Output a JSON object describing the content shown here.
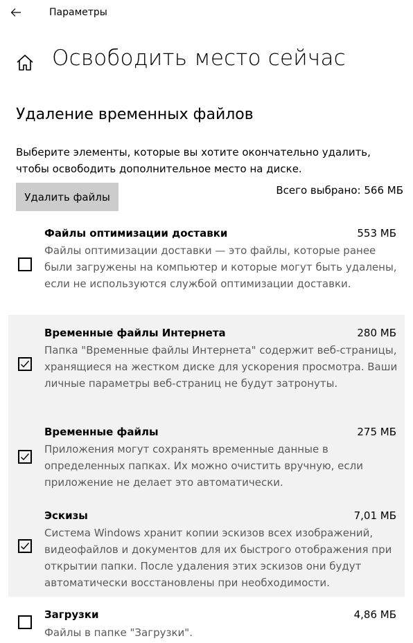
{
  "app": {
    "title": "Параметры"
  },
  "page": {
    "title": "Освободить место сейчас",
    "section_title": "Удаление временных файлов",
    "description": "Выберите элементы, которые вы хотите окончательно удалить, чтобы освободить дополнительное место на диске.",
    "delete_button": "Удалить файлы",
    "total_selected": "Всего выбрано: 566 МБ"
  },
  "items": [
    {
      "name": "Файлы оптимизации доставки",
      "size": "553 МБ",
      "checked": false,
      "description": "Файлы оптимизации доставки — это файлы, которые ранее были загружены на компьютер и которые могут быть удалены, если не используются службой оптимизации доставки."
    },
    {
      "name": "Временные файлы Интернета",
      "size": "280 МБ",
      "checked": true,
      "description": "Папка \"Временные файлы Интернета\" содержит веб-страницы, хранящиеся на жестком диске для ускорения просмотра. Ваши личные параметры веб-страниц не будут затронуты."
    },
    {
      "name": "Временные файлы",
      "size": "275 МБ",
      "checked": true,
      "description": "Приложения могут сохранять временные данные в определенных папках. Их можно очистить вручную, если приложение не делает это автоматически."
    },
    {
      "name": "Эскизы",
      "size": "7,01 МБ",
      "checked": true,
      "description": "Система Windows хранит копии эскизов всех изображений, видеофайлов и документов для их быстрого отображения при открытии папки. После удаления этих эскизов они будут автоматически восстановлены при необходимости."
    },
    {
      "name": "Загрузки",
      "size": "4,86 МБ",
      "checked": false,
      "description": "Файлы в папке \"Загрузки\"."
    }
  ],
  "icons": {
    "back": "back-arrow-icon",
    "home": "home-icon",
    "checkmark": "checkmark-icon"
  },
  "colors": {
    "selected_row_bg": "#f2f2f2",
    "button_bg": "#cccccc",
    "secondary_text": "#5a5a5a"
  }
}
